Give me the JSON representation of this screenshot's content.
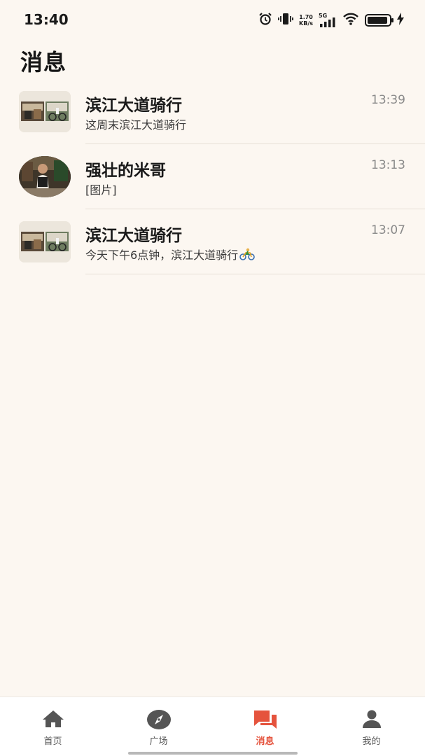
{
  "status_bar": {
    "time": "13:40",
    "net_speed_value": "1.70",
    "net_speed_unit": "KB/s",
    "signal_type": "5G",
    "icons": [
      "alarm-icon",
      "vibrate-icon",
      "wifi-icon",
      "battery-icon",
      "charging-icon"
    ]
  },
  "header": {
    "title": "消息"
  },
  "conversations": [
    {
      "name": "滨江大道骑行",
      "preview": "这周末滨江大道骑行",
      "time": "13:39",
      "avatar": "group"
    },
    {
      "name": "强壮的米哥",
      "preview": "[图片]",
      "time": "13:13",
      "avatar": "user"
    },
    {
      "name": "滨江大道骑行",
      "preview": "今天下午6点钟，滨江大道骑行",
      "time": "13:07",
      "avatar": "group",
      "preview_emoji": "bike-icon"
    }
  ],
  "bottom_nav": {
    "items": [
      {
        "label": "首页",
        "icon": "home-icon"
      },
      {
        "label": "广场",
        "icon": "compass-icon"
      },
      {
        "label": "消息",
        "icon": "chat-icon",
        "active": true
      },
      {
        "label": "我的",
        "icon": "person-icon"
      }
    ]
  },
  "colors": {
    "background": "#fcf7f1",
    "accent": "#e5533d",
    "nav_inactive": "#555555"
  }
}
